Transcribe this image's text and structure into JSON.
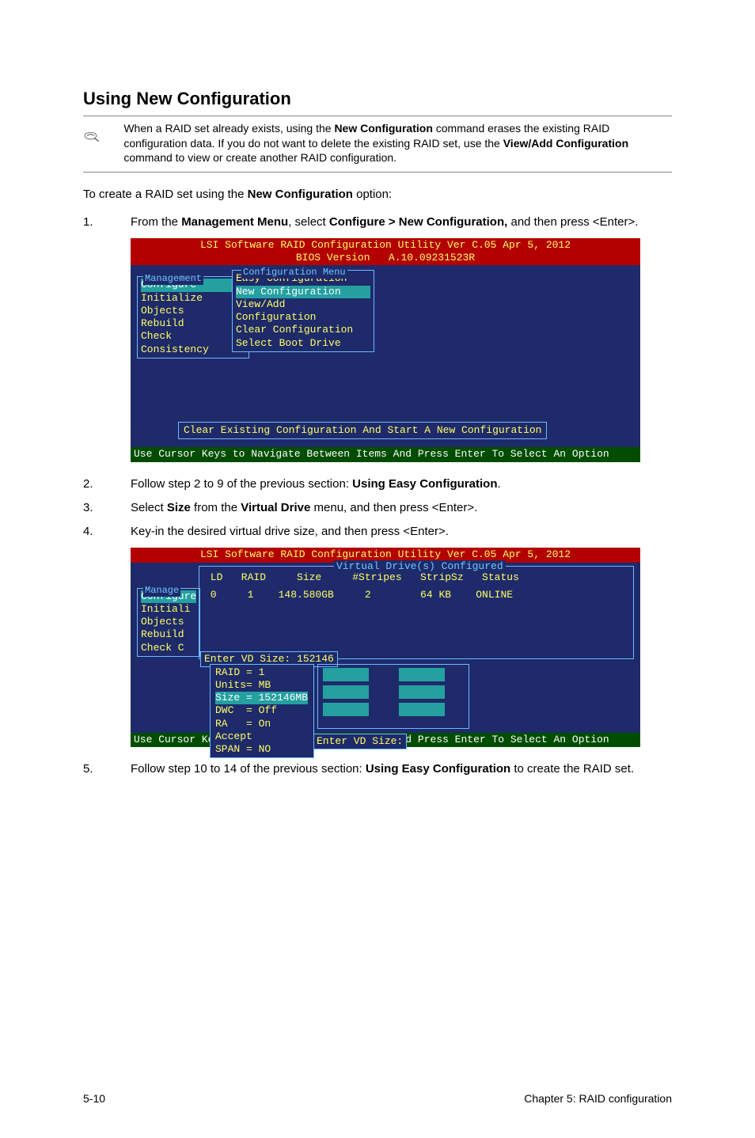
{
  "title": "Using New Configuration",
  "note": {
    "line1_a": "When a RAID set already exists, using the ",
    "line1_b": "New Configuration",
    "line1_c": " command erases the existing RAID configuration data. If you do not want to delete the existing RAID set, use the ",
    "line1_d": "View/Add Configuration",
    "line1_e": " command to view or create another RAID configuration."
  },
  "intro": {
    "a": "To create a RAID set using the ",
    "b": "New Configuration",
    "c": " option:"
  },
  "steps": {
    "s1": {
      "num": "1.",
      "a": "From the ",
      "b": "Management Menu",
      "c": ", select ",
      "d": "Configure > New Configuration,",
      "e": " and then press <Enter>."
    },
    "s2": {
      "num": "2.",
      "a": "Follow step 2 to 9 of the previous section: ",
      "b": "Using Easy Configuration",
      "c": "."
    },
    "s3": {
      "num": "3.",
      "a": "Select ",
      "b": "Size",
      "c": " from the ",
      "d": "Virtual Drive",
      "e": " menu, and then press <Enter>."
    },
    "s4": {
      "num": "4.",
      "a": "Key-in the desired virtual drive size, and then press <Enter>."
    },
    "s5": {
      "num": "5.",
      "a": "Follow step 10 to 14 of the previous section: ",
      "b": "Using Easy Configuration",
      "c": " to create the RAID set."
    }
  },
  "bios1": {
    "header_line1": "LSI Software RAID Configuration Utility Ver C.05 Apr 5, 2012",
    "header_line2": "BIOS Version   A.10.09231523R",
    "mgmt_title": "Management",
    "cfg_title": "Configuration Menu",
    "mgmt_items": [
      "Configure",
      "Initialize",
      "Objects",
      "Rebuild",
      "Check Consistency"
    ],
    "cfg_items": [
      "Easy Configuration",
      "New Configuration",
      "View/Add Configuration",
      "Clear Configuration",
      "Select Boot Drive"
    ],
    "status": "Clear Existing Configuration And Start A New Configuration",
    "footer": "Use Cursor Keys to Navigate Between Items And Press Enter To Select An Option"
  },
  "bios2": {
    "header_line1": "LSI Software RAID Configuration Utility Ver C.05 Apr 5, 2012",
    "vd_title": "Virtual Drive(s) Configured",
    "vd_headers": " LD   RAID     Size     #Stripes   StripSz   Status",
    "vd_row": " 0     1    148.580GB     2        64 KB    ONLINE",
    "mgmt_title": "Manage",
    "mgmt_items": [
      "Configure",
      "Initiali",
      "Objects",
      "Rebuild",
      "Check C"
    ],
    "vd_size_label": "Enter VD Size: 152146",
    "params": {
      "p1": "RAID = 1",
      "p2": "Units= MB",
      "p3": "Size = 152146MB",
      "p4": "DWC  = Off",
      "p5": "RA   = On",
      "p6": "Accept",
      "p7": "SPAN = NO"
    },
    "enter_vd": "Enter VD Size:",
    "footer": "Use Cursor Keys to Navigate Between Items And Press Enter To Select An Option"
  },
  "footer": {
    "left": "5-10",
    "right": "Chapter 5: RAID configuration"
  }
}
